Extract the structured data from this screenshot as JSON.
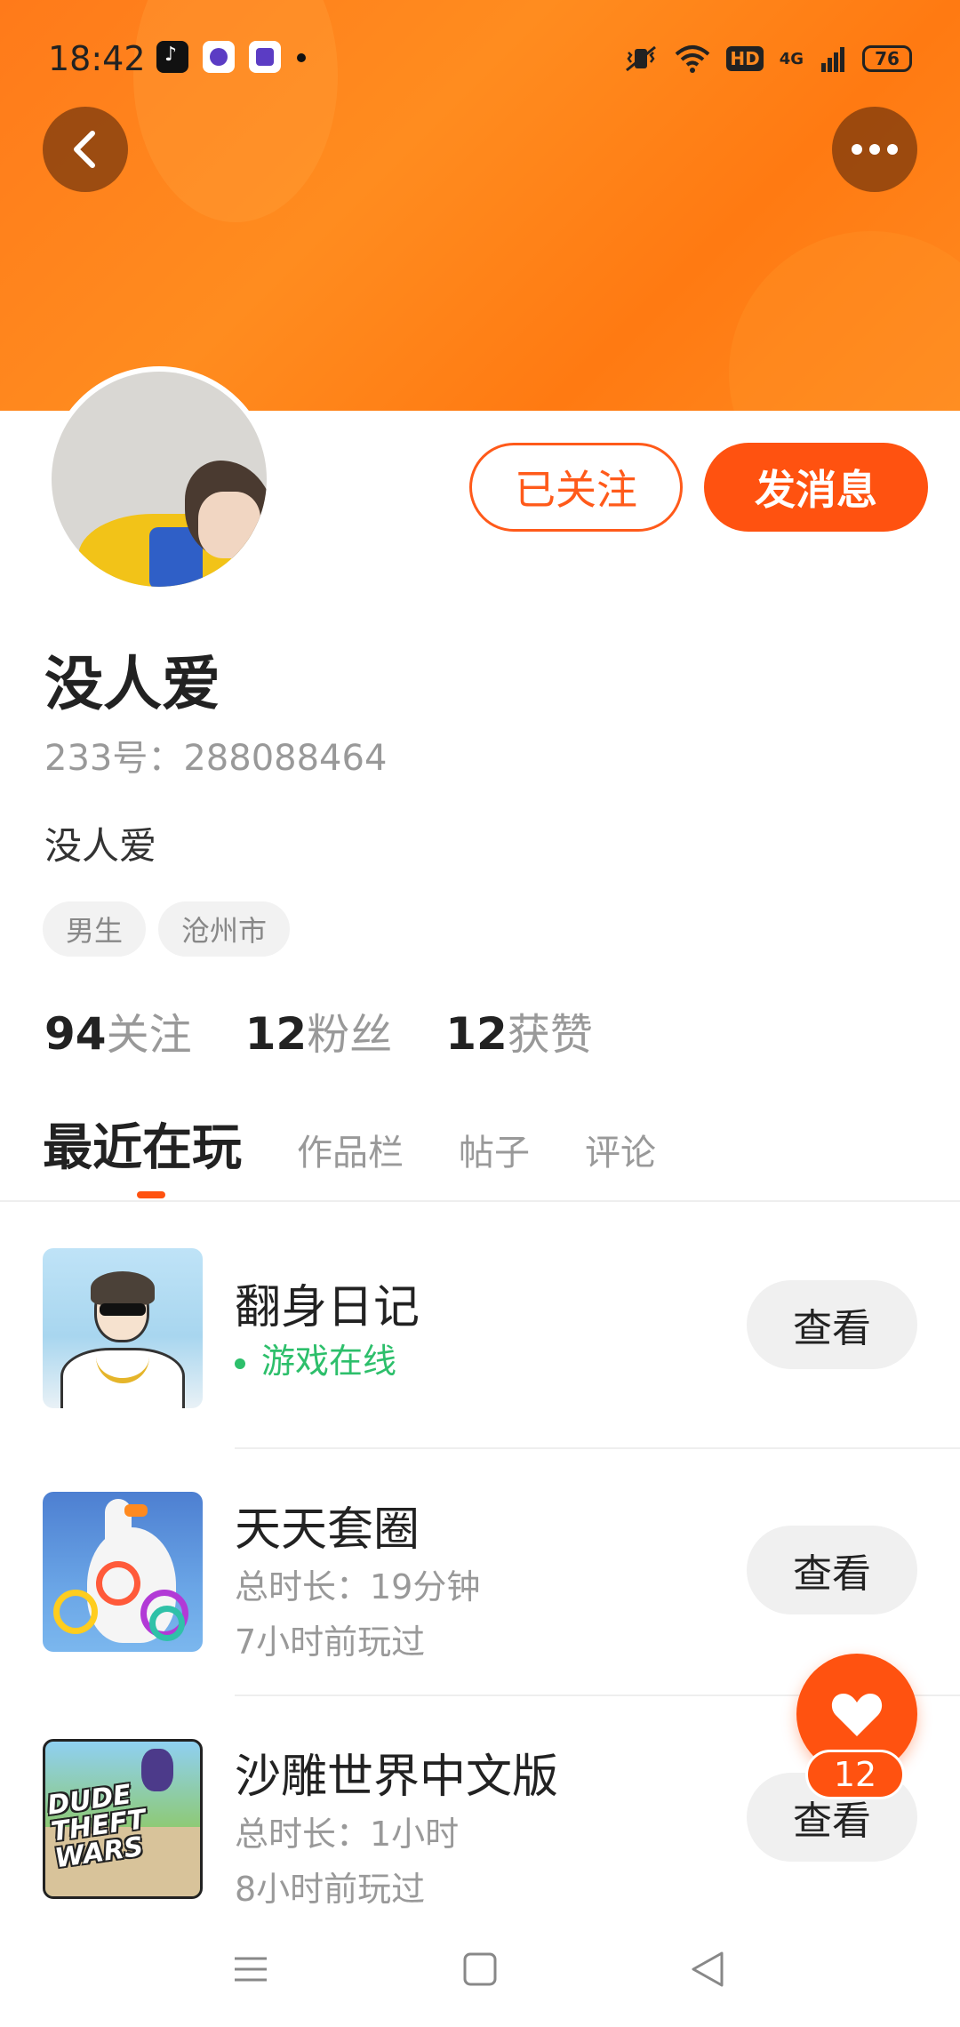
{
  "status_bar": {
    "time": "18:42",
    "network": "4G",
    "hd_label": "HD",
    "battery": "76",
    "notification_icons": [
      "tiktok-icon",
      "app-icon",
      "app-icon"
    ]
  },
  "header": {
    "back_icon": "chevron-left-icon",
    "more_icon": "more-dots-icon",
    "banner_color": "#ff7d18"
  },
  "profile": {
    "avatar_icon": "avatar",
    "follow_label": "已关注",
    "message_label": "发消息",
    "username": "没人爱",
    "user_id": "233号：288088464",
    "bio": "没人爱",
    "tags": [
      "男生",
      "沧州市"
    ],
    "stats": [
      {
        "num": "94",
        "label": "关注"
      },
      {
        "num": "12",
        "label": "粉丝"
      },
      {
        "num": "12",
        "label": "获赞"
      }
    ]
  },
  "tabs": [
    {
      "label": "最近在玩",
      "active": true
    },
    {
      "label": "作品栏",
      "active": false
    },
    {
      "label": "帖子",
      "active": false
    },
    {
      "label": "评论",
      "active": false
    }
  ],
  "games": [
    {
      "name": "翻身日记",
      "status": "游戏在线",
      "button": "查看"
    },
    {
      "name": "天天套圈",
      "duration": "总时长：19分钟",
      "last_played": "7小时前玩过",
      "button": "查看"
    },
    {
      "name": "沙雕世界中文版",
      "duration": "总时长：1小时",
      "last_played": "8小时前玩过",
      "button": "查看",
      "icon_text": "DUDE THEFT WARS"
    }
  ],
  "like_fab": {
    "icon": "heart-icon",
    "count": "12"
  },
  "colors": {
    "accent": "#ff5210",
    "online": "#2dbf6b"
  }
}
